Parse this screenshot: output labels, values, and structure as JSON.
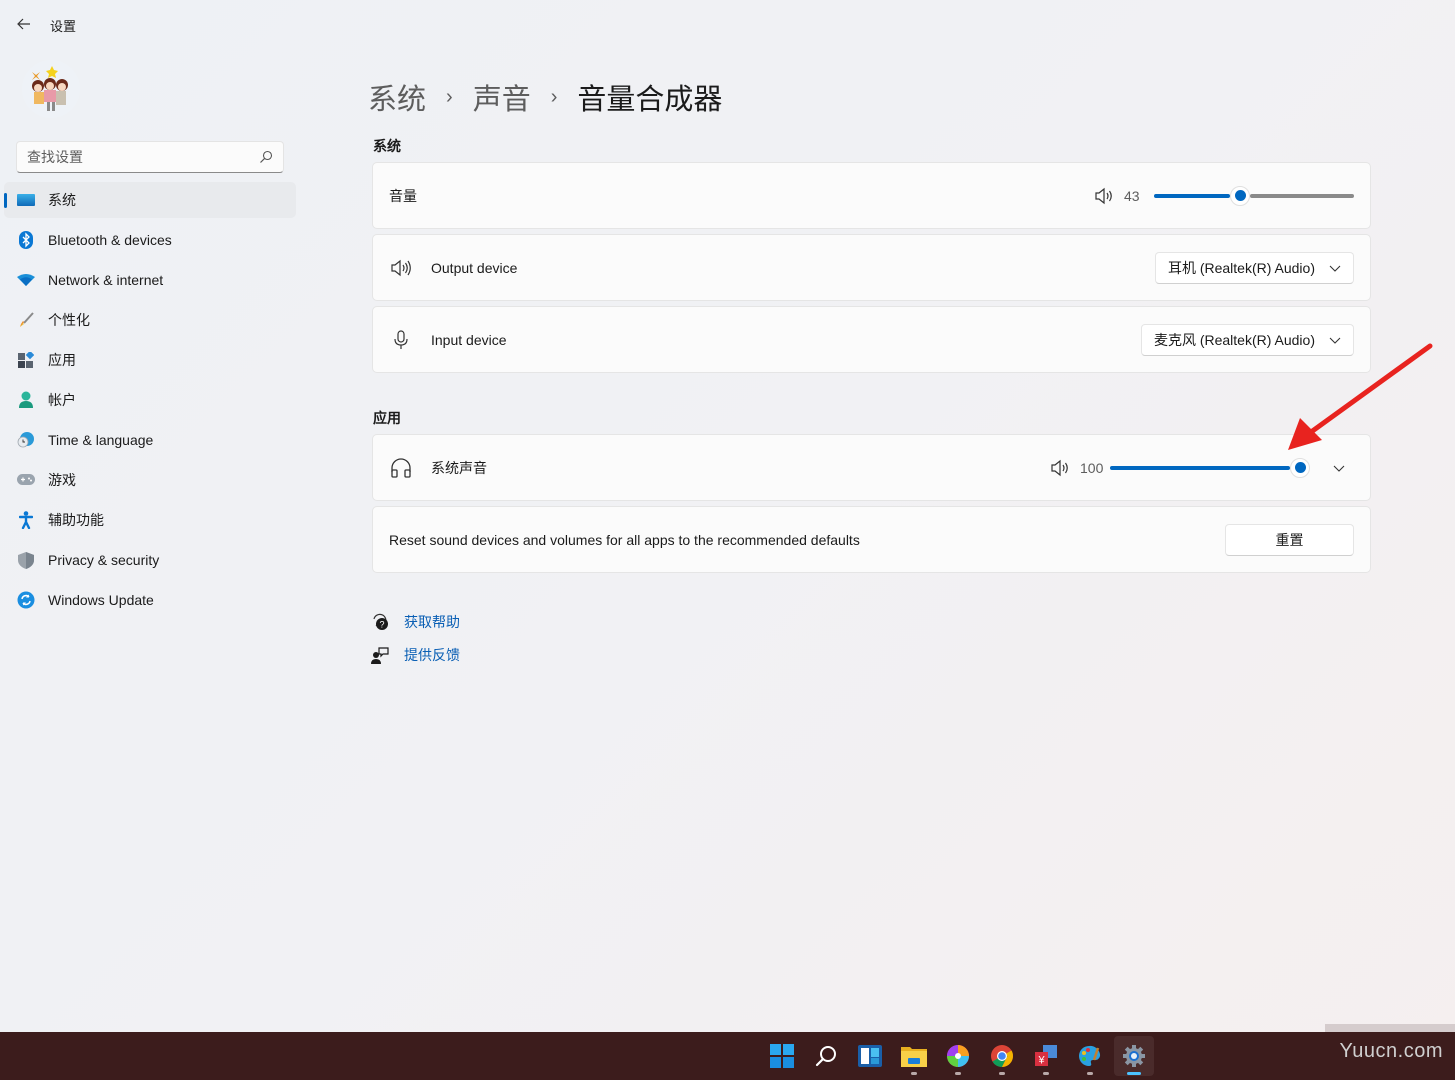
{
  "window": {
    "title": "设置",
    "back_icon": "arrow-left-icon"
  },
  "sidebar": {
    "avatar_icon": "user-avatar-cartoon-family",
    "search": {
      "placeholder": "查找设置",
      "value": "",
      "icon": "search-icon"
    },
    "items": [
      {
        "label": "系统",
        "icon": "monitor-icon",
        "active": true
      },
      {
        "label": "Bluetooth & devices",
        "icon": "bluetooth-icon",
        "active": false
      },
      {
        "label": "Network & internet",
        "icon": "wifi-icon",
        "active": false
      },
      {
        "label": "个性化",
        "icon": "paintbrush-icon",
        "active": false
      },
      {
        "label": "应用",
        "icon": "apps-icon",
        "active": false
      },
      {
        "label": "帐户",
        "icon": "person-icon",
        "active": false
      },
      {
        "label": "Time & language",
        "icon": "clock-globe-icon",
        "active": false
      },
      {
        "label": "游戏",
        "icon": "gamepad-icon",
        "active": false
      },
      {
        "label": "辅助功能",
        "icon": "accessibility-icon",
        "active": false
      },
      {
        "label": "Privacy & security",
        "icon": "shield-icon",
        "active": false
      },
      {
        "label": "Windows Update",
        "icon": "update-icon",
        "active": false
      }
    ]
  },
  "breadcrumb": {
    "parts": [
      "系统",
      "声音"
    ],
    "separator": "›",
    "current": "音量合成器"
  },
  "system_section": {
    "title": "系统",
    "volume": {
      "label": "音量",
      "value": "43",
      "percent": 43,
      "icon": "speaker-icon"
    },
    "output_device": {
      "label": "Output device",
      "icon": "speaker-icon",
      "selected": "耳机 (Realtek(R) Audio)"
    },
    "input_device": {
      "label": "Input device",
      "icon": "microphone-icon",
      "selected": "麦克风 (Realtek(R) Audio)"
    }
  },
  "apps_section": {
    "title": "应用",
    "system_sounds": {
      "label": "系统声音",
      "icon": "headphones-icon",
      "value": "100",
      "percent": 100
    },
    "reset": {
      "description": "Reset sound devices and volumes for all apps to the recommended defaults",
      "button_label": "重置"
    }
  },
  "help": {
    "get_help": "获取帮助",
    "give_feedback": "提供反馈"
  },
  "annotation": {
    "type": "red-arrow",
    "color": "#e8231f"
  },
  "taskbar": {
    "apps": [
      {
        "name": "start",
        "icon": "windows-logo-icon",
        "running": false,
        "active": false
      },
      {
        "name": "search",
        "icon": "search-icon",
        "running": false,
        "active": false
      },
      {
        "name": "widgets",
        "icon": "widgets-icon",
        "running": false,
        "active": false
      },
      {
        "name": "file-explorer",
        "icon": "folder-icon",
        "running": true,
        "active": false
      },
      {
        "name": "photos-pinwheel",
        "icon": "pinwheel-icon",
        "running": true,
        "active": false
      },
      {
        "name": "chrome",
        "icon": "chrome-icon",
        "running": true,
        "active": false
      },
      {
        "name": "input-method",
        "icon": "yen-translate-icon",
        "running": true,
        "active": false
      },
      {
        "name": "paint",
        "icon": "palette-icon",
        "running": true,
        "active": false
      },
      {
        "name": "settings",
        "icon": "gear-icon",
        "running": true,
        "active": true
      }
    ],
    "watermark": "Yuucn.com"
  }
}
